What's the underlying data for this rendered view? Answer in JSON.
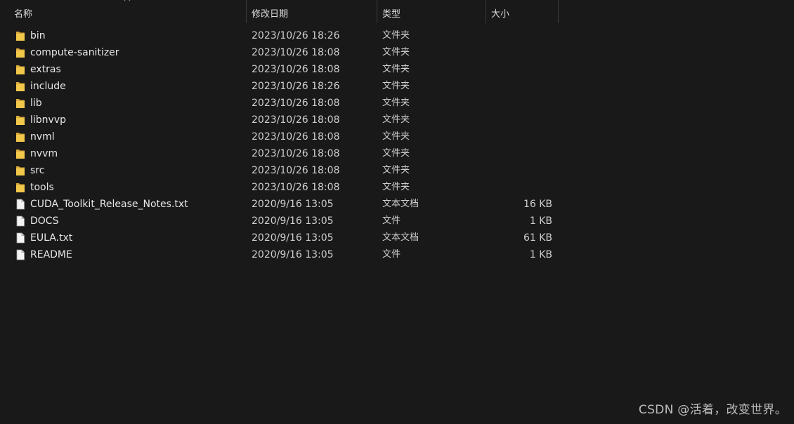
{
  "header": {
    "name": "名称",
    "date": "修改日期",
    "type": "类型",
    "size": "大小",
    "sort_icon": "chevron-up-icon"
  },
  "colors": {
    "background": "#191919",
    "folder": "#f2c84b",
    "file": "#f4f4f4"
  },
  "rows": [
    {
      "kind": "folder",
      "name": "bin",
      "date": "2023/10/26 18:26",
      "type": "文件夹",
      "size": ""
    },
    {
      "kind": "folder",
      "name": "compute-sanitizer",
      "date": "2023/10/26 18:08",
      "type": "文件夹",
      "size": ""
    },
    {
      "kind": "folder",
      "name": "extras",
      "date": "2023/10/26 18:08",
      "type": "文件夹",
      "size": ""
    },
    {
      "kind": "folder",
      "name": "include",
      "date": "2023/10/26 18:26",
      "type": "文件夹",
      "size": ""
    },
    {
      "kind": "folder",
      "name": "lib",
      "date": "2023/10/26 18:08",
      "type": "文件夹",
      "size": ""
    },
    {
      "kind": "folder",
      "name": "libnvvp",
      "date": "2023/10/26 18:08",
      "type": "文件夹",
      "size": ""
    },
    {
      "kind": "folder",
      "name": "nvml",
      "date": "2023/10/26 18:08",
      "type": "文件夹",
      "size": ""
    },
    {
      "kind": "folder",
      "name": "nvvm",
      "date": "2023/10/26 18:08",
      "type": "文件夹",
      "size": ""
    },
    {
      "kind": "folder",
      "name": "src",
      "date": "2023/10/26 18:08",
      "type": "文件夹",
      "size": ""
    },
    {
      "kind": "folder",
      "name": "tools",
      "date": "2023/10/26 18:08",
      "type": "文件夹",
      "size": ""
    },
    {
      "kind": "file",
      "name": "CUDA_Toolkit_Release_Notes.txt",
      "date": "2020/9/16 13:05",
      "type": "文本文档",
      "size": "16 KB"
    },
    {
      "kind": "file",
      "name": "DOCS",
      "date": "2020/9/16 13:05",
      "type": "文件",
      "size": "1 KB"
    },
    {
      "kind": "file",
      "name": "EULA.txt",
      "date": "2020/9/16 13:05",
      "type": "文本文档",
      "size": "61 KB"
    },
    {
      "kind": "file",
      "name": "README",
      "date": "2020/9/16 13:05",
      "type": "文件",
      "size": "1 KB"
    }
  ],
  "watermark": "CSDN @活着，改变世界。"
}
